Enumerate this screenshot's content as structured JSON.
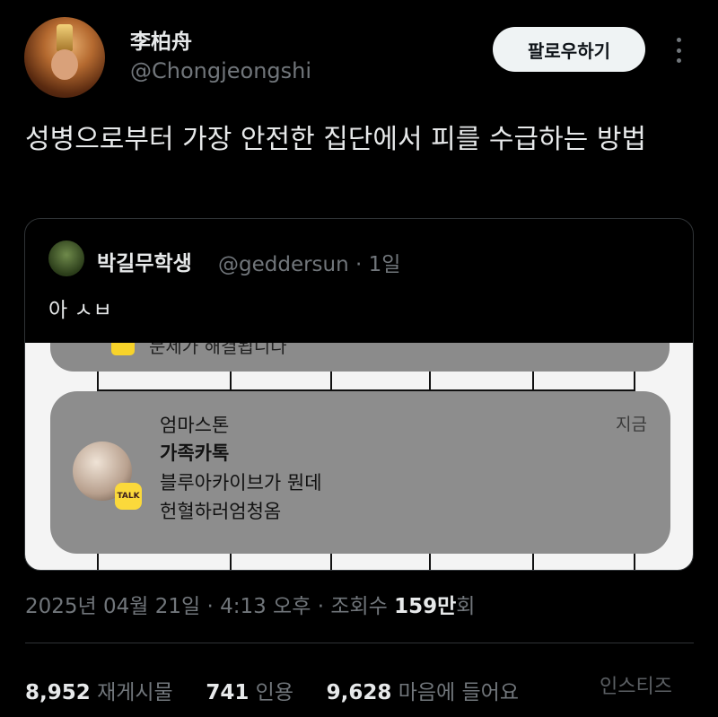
{
  "author": {
    "display_name": "李柏舟",
    "handle": "@Chongjeongshi"
  },
  "follow_label": "팔로우하기",
  "tweet_text": "성병으로부터 가장 안전한 집단에서 피를 수급하는 방법",
  "quote": {
    "name": "박길무학생",
    "meta": "@geddersun · 1일",
    "text": "아 ㅅㅂ",
    "notification": {
      "top_cut_text": "문제가 해결됩니다",
      "title": "엄마스톤",
      "subtitle": "가족카톡",
      "line1": "블루아카이브가 뭔데",
      "line2": "헌혈하러엄청옴",
      "time": "지금",
      "badge": "TALK"
    }
  },
  "timestamp": {
    "date": "2025년 04월 21일 · 4:13 오후 · 조회수 ",
    "views": "159만",
    "suffix": "회"
  },
  "stats": {
    "reposts_count": "8,952",
    "reposts_label": "재게시물",
    "quotes_count": "741",
    "quotes_label": "인용",
    "likes_count": "9,628",
    "likes_label": "마음에 들어요"
  },
  "watermark": "인스티즈"
}
